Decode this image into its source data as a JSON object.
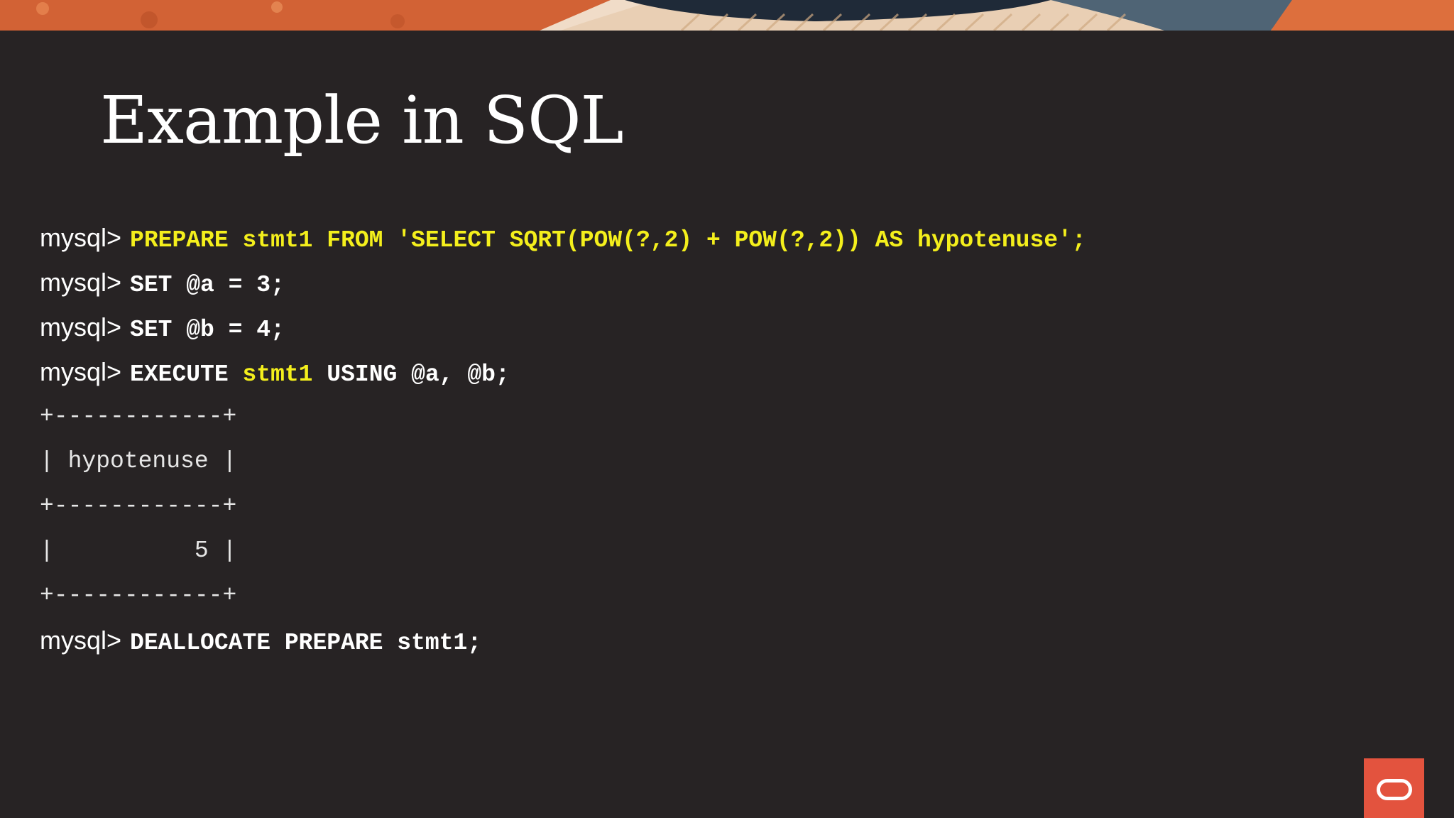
{
  "slide": {
    "title": "Example in SQL",
    "brand_color": "#e3533e",
    "logo_icon": "oracle-logo-icon"
  },
  "terminal": {
    "prompt": "mysql>",
    "lines": [
      {
        "type": "command",
        "segments": [
          {
            "text": "PREPARE stmt1 FROM 'SELECT SQRT(POW(?,2) + POW(?,2)) AS hypotenuse';",
            "color": "#f4ef1c"
          }
        ]
      },
      {
        "type": "command",
        "segments": [
          {
            "text": "SET @a = 3;",
            "color": "#ffffff"
          }
        ]
      },
      {
        "type": "command",
        "segments": [
          {
            "text": "SET @b = 4;",
            "color": "#ffffff"
          }
        ]
      },
      {
        "type": "command",
        "segments": [
          {
            "text": "EXECUTE ",
            "color": "#ffffff"
          },
          {
            "text": "stmt1",
            "color": "#f4ef1c"
          },
          {
            "text": " USING @a, @b;",
            "color": "#ffffff"
          }
        ]
      },
      {
        "type": "result",
        "text": "+------------+"
      },
      {
        "type": "result",
        "text": "| hypotenuse |"
      },
      {
        "type": "result",
        "text": "+------------+"
      },
      {
        "type": "result",
        "text": "|          5 |"
      },
      {
        "type": "result",
        "text": "+------------+"
      },
      {
        "type": "command",
        "segments": [
          {
            "text": "DEALLOCATE PREPARE stmt1;",
            "color": "#ffffff"
          }
        ]
      }
    ]
  }
}
